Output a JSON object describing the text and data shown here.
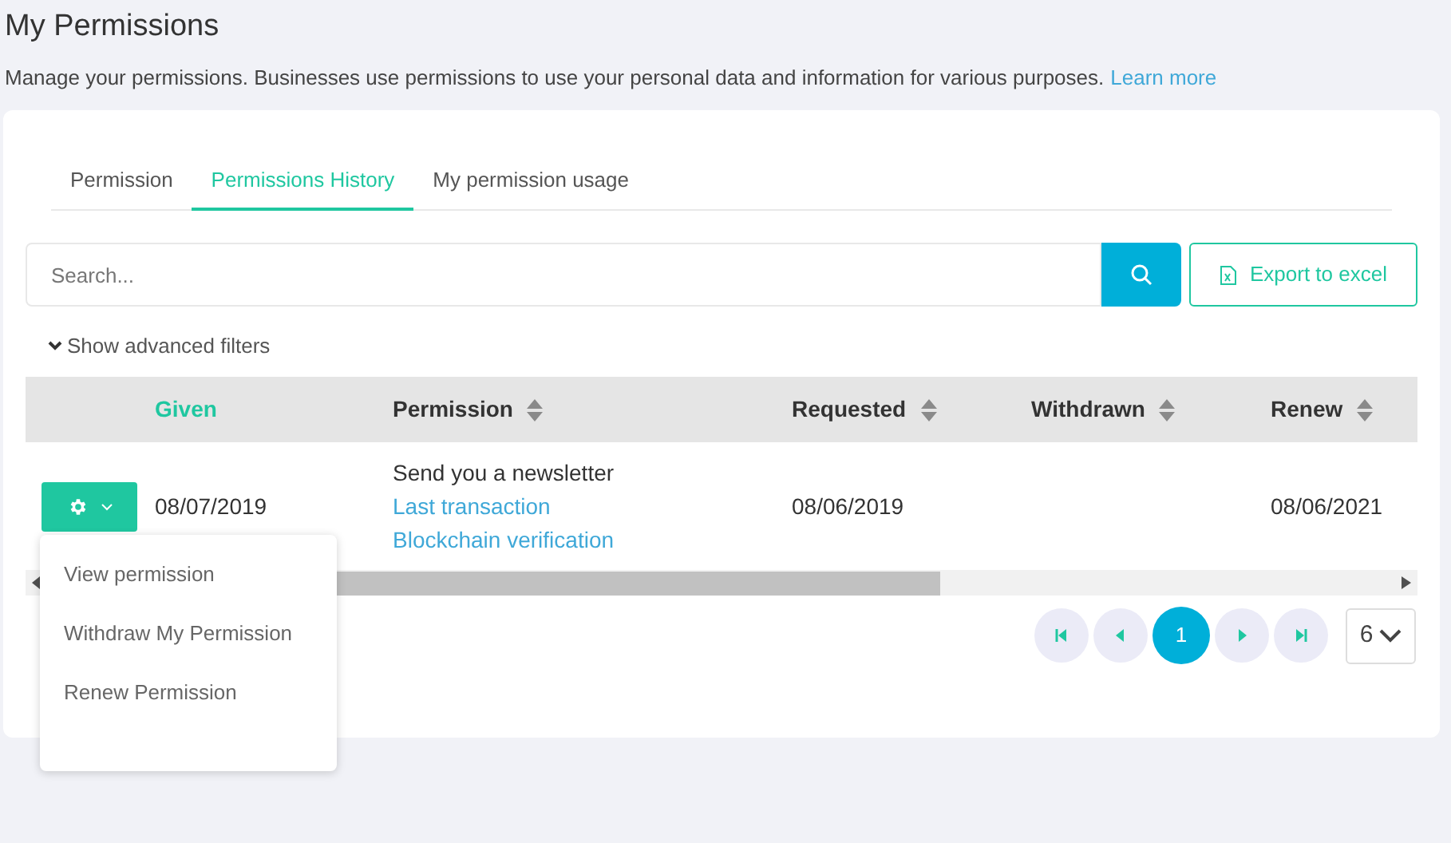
{
  "page": {
    "title": "My Permissions",
    "description": "Manage your permissions. Businesses use permissions to use your personal data and information for various purposes.",
    "learn_more_link": "Learn more"
  },
  "tabs": [
    {
      "label": "Permission",
      "selected": false
    },
    {
      "label": "Permissions History",
      "selected": true
    },
    {
      "label": "My permission usage",
      "selected": false
    }
  ],
  "search": {
    "placeholder": "Search..."
  },
  "export_button": "Export to excel",
  "advanced_filters": "Show advanced filters",
  "table": {
    "columns": [
      {
        "label": "Given",
        "sortable": false,
        "active": true
      },
      {
        "label": "Permission",
        "sortable": true,
        "active": false
      },
      {
        "label": "Requested",
        "sortable": true,
        "active": false
      },
      {
        "label": "Withdrawn",
        "sortable": true,
        "active": false
      },
      {
        "label": "Renew",
        "sortable": true,
        "active": false
      }
    ],
    "rows": [
      {
        "given": "08/07/2019",
        "permission": "Send you a newsletter",
        "links": [
          "Last transaction",
          "Blockchain verification"
        ],
        "requested": "08/06/2019",
        "renew": "08/06/2021"
      }
    ]
  },
  "action_menu": {
    "items": [
      "View permission",
      "Withdraw My Permission",
      "Renew Permission"
    ]
  },
  "pagination": {
    "pages": [
      {
        "label": "1",
        "selected": true
      }
    ],
    "page_size": "6"
  }
}
